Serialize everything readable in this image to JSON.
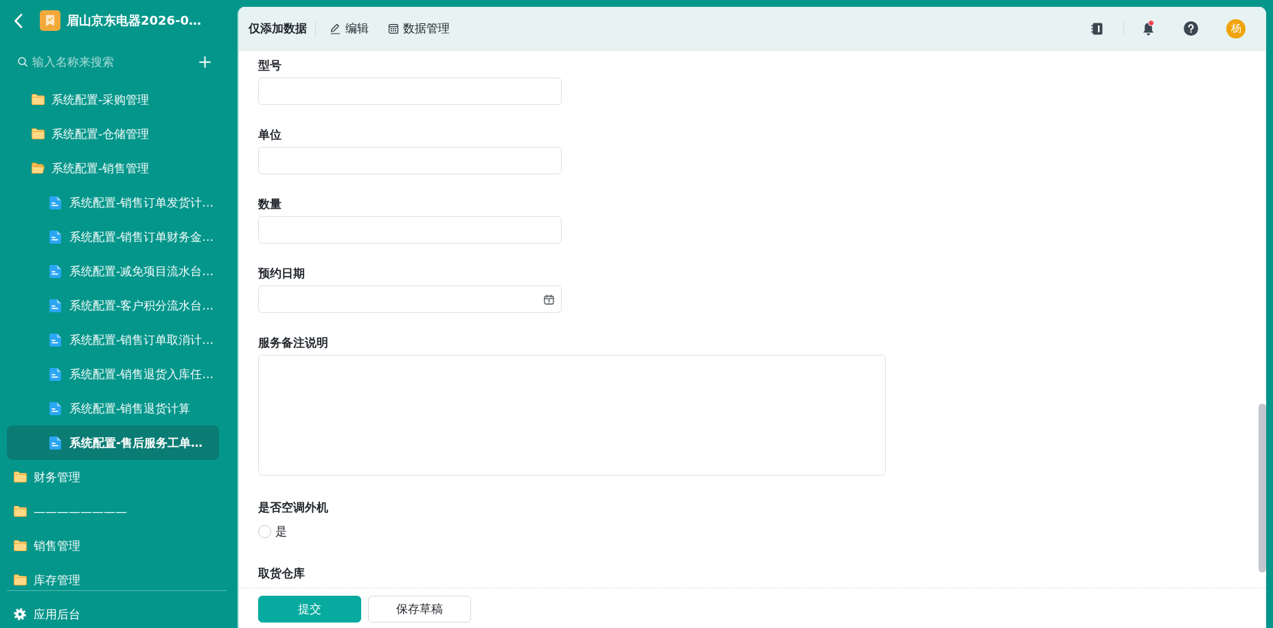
{
  "sidebar": {
    "title": "眉山京东电器2026-0…",
    "search": {
      "placeholder": "输入名称来搜索"
    },
    "tree": [
      {
        "children": [
          {
            "kind": "folder",
            "label": "系统配置-采购管理",
            "expanded": false,
            "selected": false
          },
          {
            "kind": "folder",
            "label": "系统配置-仓储管理",
            "expanded": false,
            "selected": false
          },
          {
            "kind": "folder",
            "label": "系统配置-销售管理",
            "expanded": true,
            "selected": false,
            "children": [
              {
                "kind": "doc",
                "label": "系统配置-销售订单发货计…",
                "selected": false
              },
              {
                "kind": "doc",
                "label": "系统配置-销售订单财务金…",
                "selected": false
              },
              {
                "kind": "doc",
                "label": "系统配置-减免项目流水台…",
                "selected": false
              },
              {
                "kind": "doc",
                "label": "系统配置-客户积分流水台…",
                "selected": false
              },
              {
                "kind": "doc",
                "label": "系统配置-销售订单取消计…",
                "selected": false
              },
              {
                "kind": "doc",
                "label": "系统配置-销售退货入库任…",
                "selected": false
              },
              {
                "kind": "doc",
                "label": "系统配置-销售退货计算",
                "selected": false
              },
              {
                "kind": "doc",
                "label": "系统配置-售后服务工单…",
                "selected": true
              }
            ]
          }
        ]
      },
      {
        "kind": "folder",
        "label": "财务管理",
        "expanded": false,
        "selected": false
      },
      {
        "kind": "folder",
        "label": "————————",
        "expanded": false,
        "selected": false
      },
      {
        "kind": "folder",
        "label": "销售管理",
        "expanded": false,
        "selected": false
      },
      {
        "kind": "folder",
        "label": "库存管理",
        "expanded": false,
        "selected": false
      }
    ],
    "footer_item": {
      "label": "应用后台"
    }
  },
  "toolbar": {
    "title": "仅添加数据",
    "actions": [
      {
        "label": "编辑"
      },
      {
        "label": "数据管理"
      }
    ],
    "has_notification": true,
    "avatar": "杨"
  },
  "form": {
    "fields": [
      {
        "kind": "text",
        "label": "型号"
      },
      {
        "kind": "text",
        "label": "单位"
      },
      {
        "kind": "text",
        "label": "数量"
      },
      {
        "kind": "date",
        "label": "预约日期"
      },
      {
        "kind": "textarea",
        "label": "服务备注说明"
      },
      {
        "kind": "radio",
        "label": "是否空调外机",
        "options": [
          {
            "label": "是",
            "selected": false
          }
        ]
      },
      {
        "kind": "label",
        "label": "取货仓库"
      }
    ]
  },
  "footer": {
    "buttons": [
      {
        "label": "提交",
        "primary": true
      },
      {
        "label": "保存草稿",
        "primary": false
      }
    ]
  }
}
